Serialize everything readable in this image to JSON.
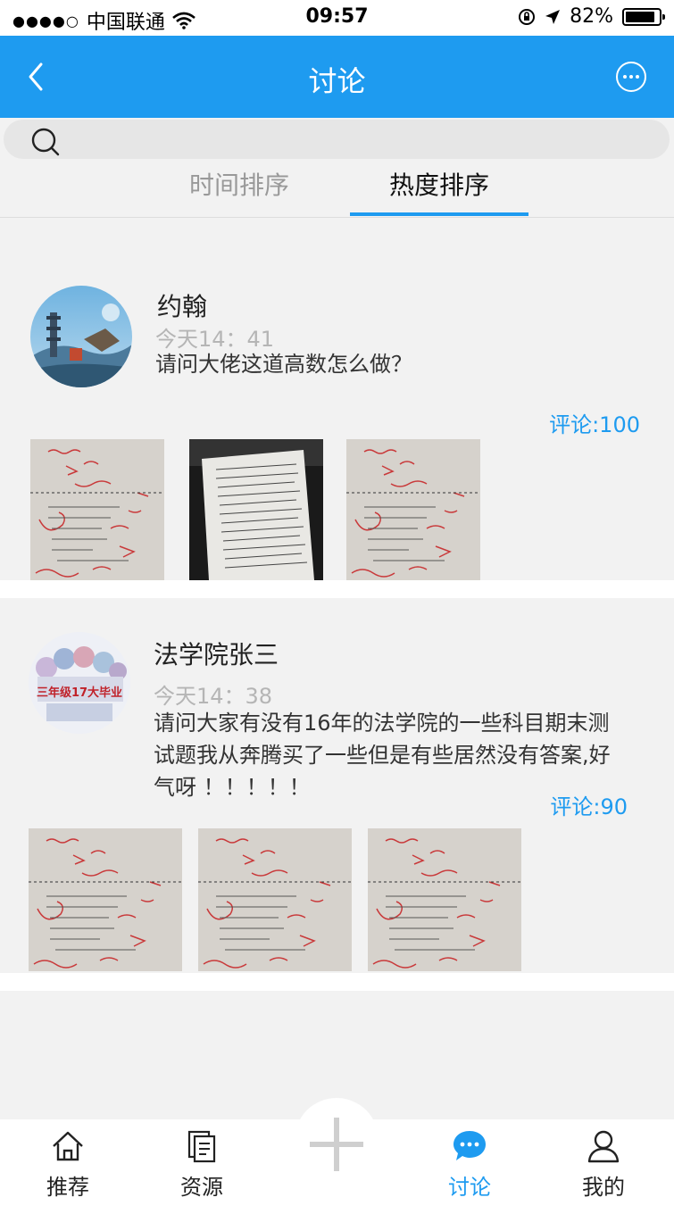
{
  "status_bar": {
    "signal": "●●●●○",
    "carrier": "中国联通",
    "time": "09:57",
    "battery_text": "82%"
  },
  "nav": {
    "title": "讨论"
  },
  "search": {
    "placeholder": ""
  },
  "tabs": [
    {
      "label": "时间排序",
      "active": false
    },
    {
      "label": "热度排序",
      "active": true
    }
  ],
  "posts": [
    {
      "author": "约翰",
      "time": "今天14：41",
      "text": "请问大佬这道高数怎么做？",
      "comments": "评论:100",
      "images": [
        "exam-paper-red-marks",
        "handwritten-paper",
        "exam-paper-red-marks"
      ]
    },
    {
      "author": "法学院张三",
      "time": "今天14：38",
      "text_lines": [
        "请问大家有没有16年的法学院的一些科目期末测",
        "试题我从奔腾买了一些但是有些居然没有答案,好",
        "气呀  ！！！！！"
      ],
      "avatar_text": "三年级17大毕业",
      "comments": "评论:90",
      "images": [
        "exam-paper-red-marks",
        "exam-paper-red-marks",
        "exam-paper-red-marks"
      ]
    }
  ],
  "tab_bar": [
    {
      "label": "推荐",
      "icon": "home-icon",
      "active": false
    },
    {
      "label": "资源",
      "icon": "documents-icon",
      "active": false
    },
    {
      "label": "",
      "icon": "plus-icon",
      "active": false
    },
    {
      "label": "讨论",
      "icon": "chat-icon",
      "active": true
    },
    {
      "label": "我的",
      "icon": "person-icon",
      "active": false
    }
  ],
  "colors": {
    "accent": "#1e9bf0",
    "background": "#f2f2f2",
    "muted_text": "#b5b5b5"
  }
}
